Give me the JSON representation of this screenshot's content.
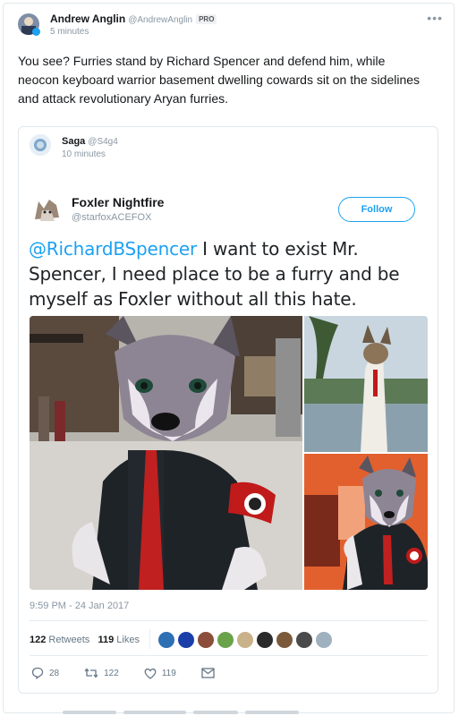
{
  "tweet": {
    "author_name": "Andrew Anglin",
    "author_handle": "@AndrewAnglin",
    "badge": "PRO",
    "time": "5 minutes",
    "more_label": "•••",
    "text": "You see? Furries stand by Richard Spencer and defend him, while neocon keyboard warrior basement dwelling cowards sit on the sidelines and attack revolutionary Aryan furries."
  },
  "quote": {
    "author_name": "Saga",
    "author_handle": "@S4g4",
    "time": "10 minutes",
    "embedded": {
      "author_name": "Foxler Nightfire",
      "author_handle": "@starfoxACEFOX",
      "follow_label": "Follow",
      "mention": "@RichardBSpencer",
      "text": " I want to exist Mr. Spencer, I need place to be a furry and be myself as Foxler without all this hate.",
      "timestamp": "9:59 PM - 24 Jan 2017",
      "retweets_count": "122",
      "retweets_label": "Retweets",
      "likes_count": "119",
      "likes_label": "Likes",
      "liker_colors": [
        "#2f6fb3",
        "#1a3fa8",
        "#8a4e3a",
        "#6aa24a",
        "#c9b28a",
        "#2b2b2b",
        "#7a5a3a",
        "#4a4a4a",
        "#9fb0bf"
      ],
      "actions": {
        "reply_icon": "reply-icon",
        "reply_count": "28",
        "retweet_icon": "retweet-icon",
        "retweet_count": "122",
        "like_icon": "heart-icon",
        "like_count": "119",
        "dm_icon": "envelope-icon"
      }
    }
  },
  "colors": {
    "accent": "#1da1f2",
    "text": "#14171a",
    "muted": "#8a97a3",
    "border": "#e1e8ed"
  }
}
